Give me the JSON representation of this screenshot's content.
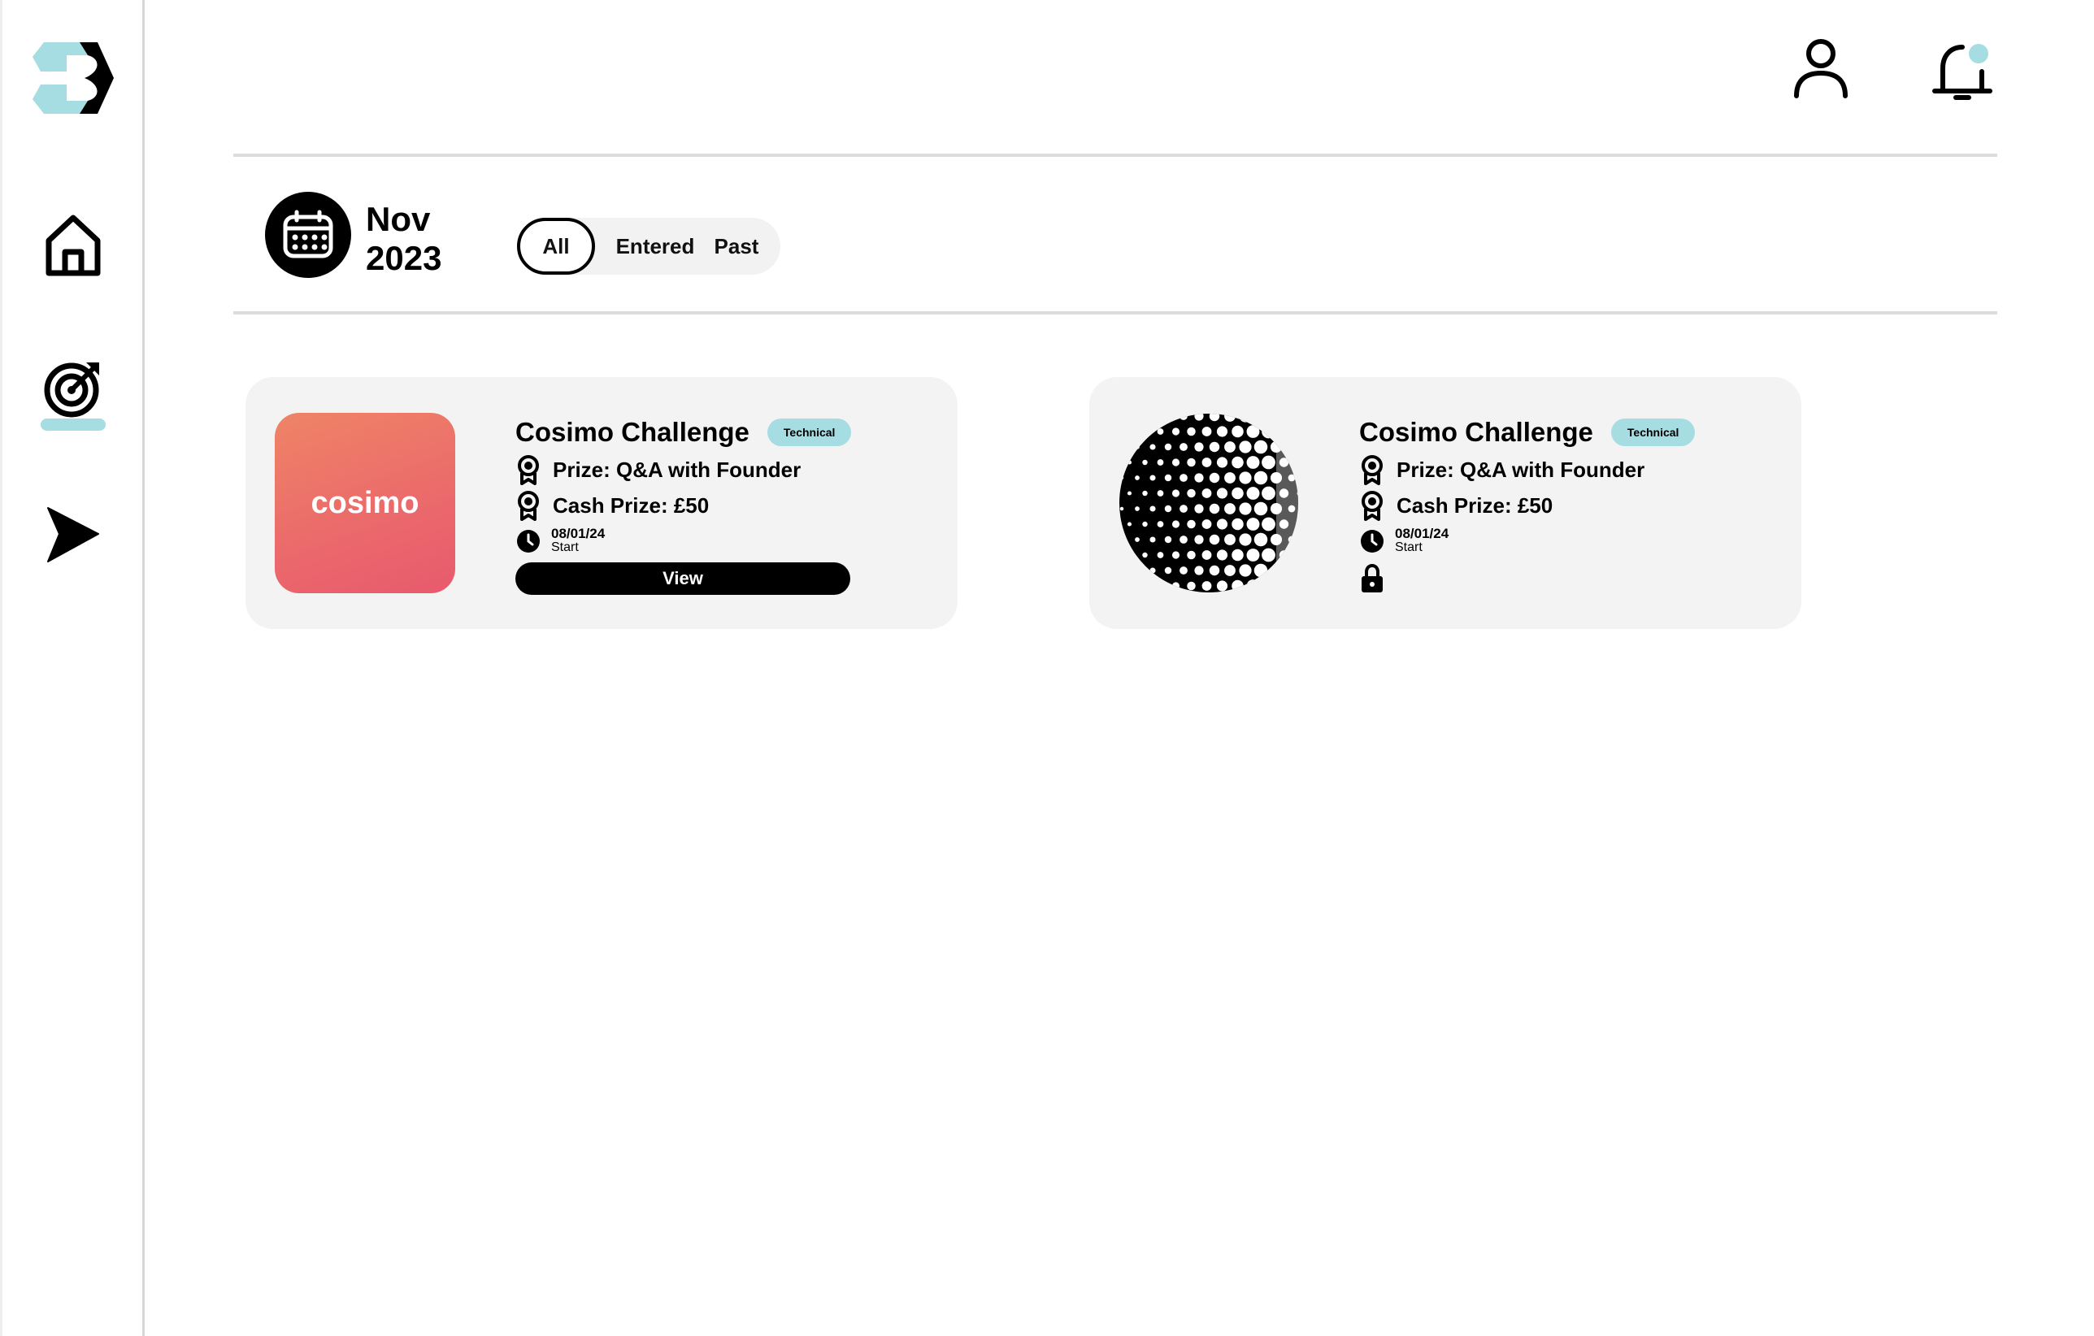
{
  "header": {
    "month": "Nov",
    "year": "2023"
  },
  "filters": {
    "all": "All",
    "entered": "Entered",
    "past": "Past",
    "selected": "All"
  },
  "colors": {
    "accent": "#a6dde3",
    "card_bg": "#f3f3f3",
    "cosimo_gradient_start": "#ef8466",
    "cosimo_gradient_end": "#e85a6e"
  },
  "icons": {
    "logo": "brand-logo-icon",
    "home": "home-icon",
    "challenges": "target-icon",
    "play": "play-icon",
    "user": "user-icon",
    "notifications": "bell-icon",
    "calendar": "calendar-icon",
    "award": "award-icon",
    "clock": "clock-icon",
    "lock": "lock-icon"
  },
  "cards": [
    {
      "thumbnail_text": "cosimo",
      "title": "Cosimo Challenge",
      "tag": "Technical",
      "prize": "Prize: Q&A with Founder",
      "cash_prize": "Cash Prize: £50",
      "date": "08/01/24",
      "date_label": "Start",
      "action": "View",
      "locked": false
    },
    {
      "title": "Cosimo Challenge",
      "tag": "Technical",
      "prize": "Prize: Q&A with Founder",
      "cash_prize": "Cash Prize: £50",
      "date": "08/01/24",
      "date_label": "Start",
      "locked": true
    }
  ]
}
